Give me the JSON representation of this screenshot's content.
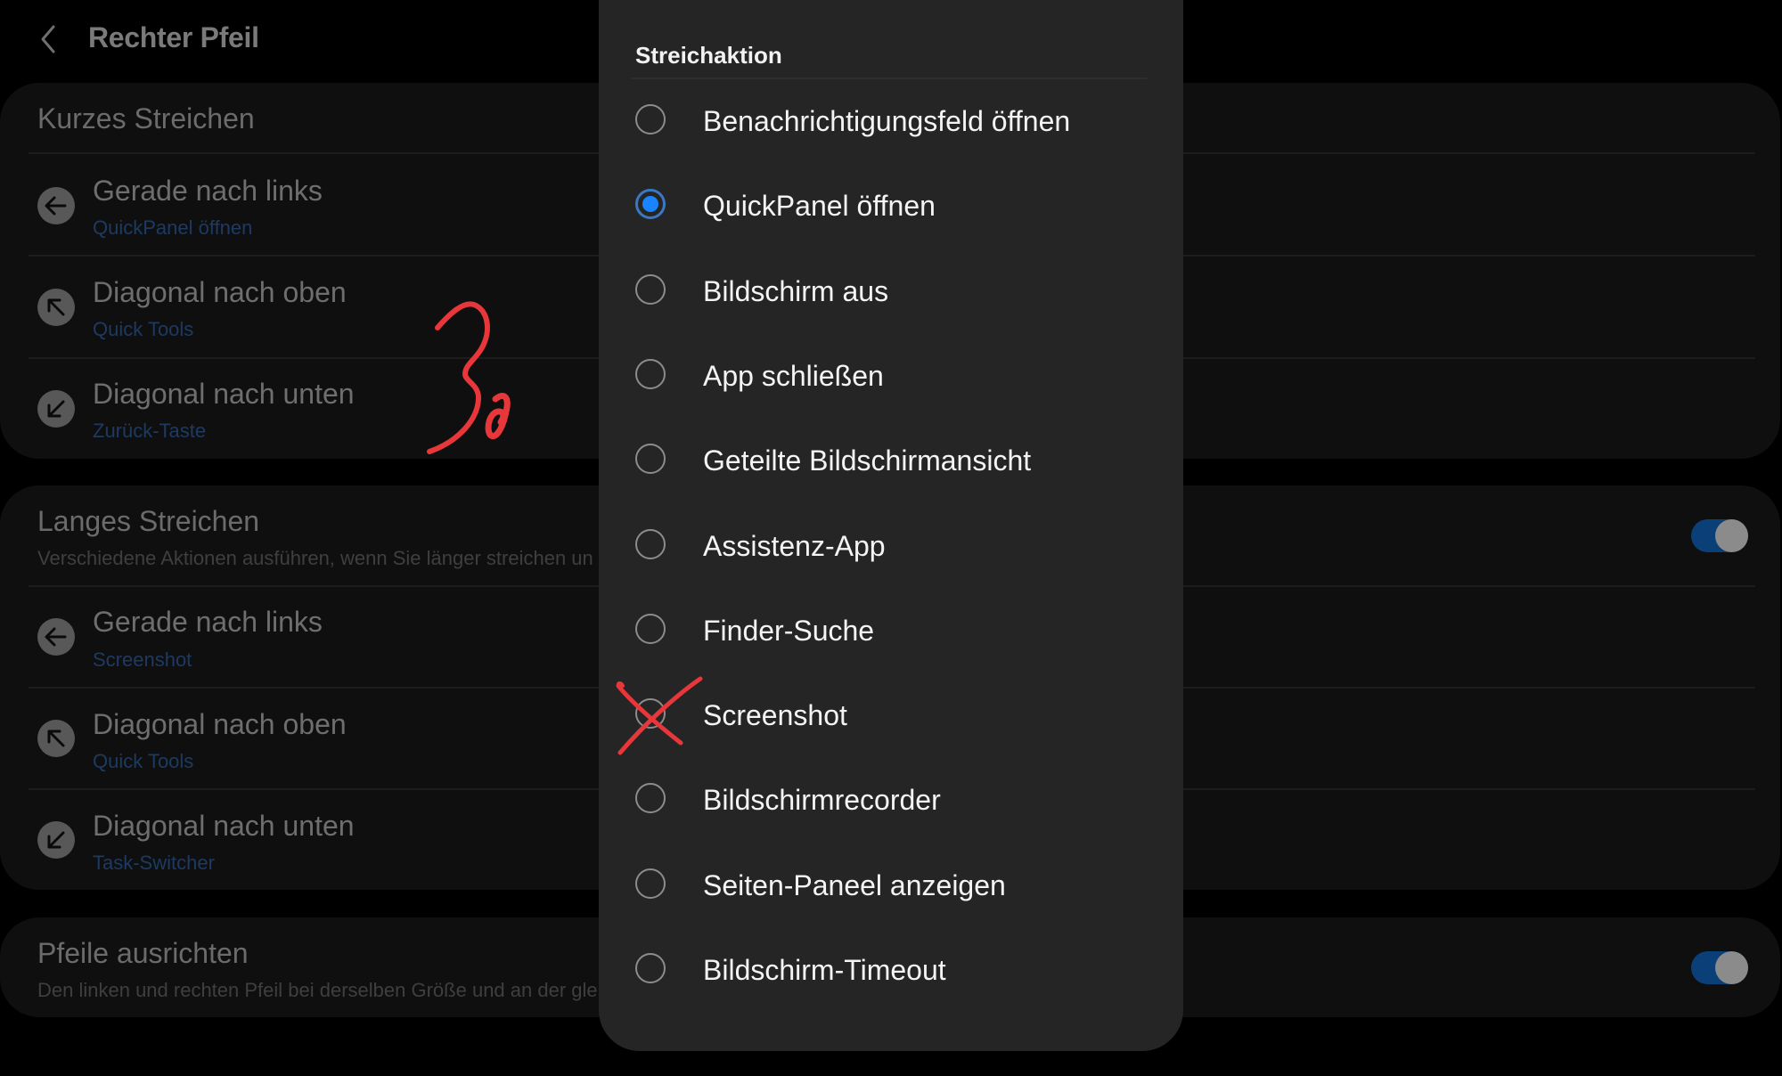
{
  "header": {
    "back_icon": "chevron-left-icon",
    "title": "Rechter Pfeil"
  },
  "short_swipe": {
    "title": "Kurzes Streichen",
    "rows": [
      {
        "icon": "arrow-left-icon",
        "title": "Gerade nach links",
        "value": "QuickPanel öffnen"
      },
      {
        "icon": "arrow-up-left-icon",
        "title": "Diagonal nach oben",
        "value": "Quick Tools"
      },
      {
        "icon": "arrow-down-left-icon",
        "title": "Diagonal nach unten",
        "value": "Zurück-Taste"
      }
    ]
  },
  "long_swipe": {
    "title": "Langes Streichen",
    "subtitle": "Verschiedene Aktionen ausführen, wenn Sie länger streichen un",
    "enabled": true,
    "rows": [
      {
        "icon": "arrow-left-icon",
        "title": "Gerade nach links",
        "value": "Screenshot"
      },
      {
        "icon": "arrow-up-left-icon",
        "title": "Diagonal nach oben",
        "value": "Quick Tools"
      },
      {
        "icon": "arrow-down-left-icon",
        "title": "Diagonal nach unten",
        "value": "Task-Switcher"
      }
    ]
  },
  "align_arrows": {
    "title": "Pfeile ausrichten",
    "subtitle": "Den linken und rechten Pfeil bei derselben Größe und an der gle",
    "enabled": true
  },
  "dialog": {
    "title": "Streichaktion",
    "selected_index": 1,
    "options": [
      "Benachrichtigungsfeld öffnen",
      "QuickPanel öffnen",
      "Bildschirm aus",
      "App schließen",
      "Geteilte Bildschirmansicht",
      "Assistenz-App",
      "Finder-Suche",
      "Screenshot",
      "Bildschirmrecorder",
      "Seiten-Paneel anzeigen",
      "Bildschirm-Timeout"
    ]
  },
  "annotations": {
    "handwritten_note": "3o",
    "crossed_out_option": "Screenshot",
    "color": "#e8373b"
  },
  "colors": {
    "accent": "#1a84ff",
    "toggle_track": "#0b3f78",
    "subtext_blue": "#1d3a63",
    "dialog_bg": "#252525",
    "card_bg": "#0f0f0f"
  }
}
